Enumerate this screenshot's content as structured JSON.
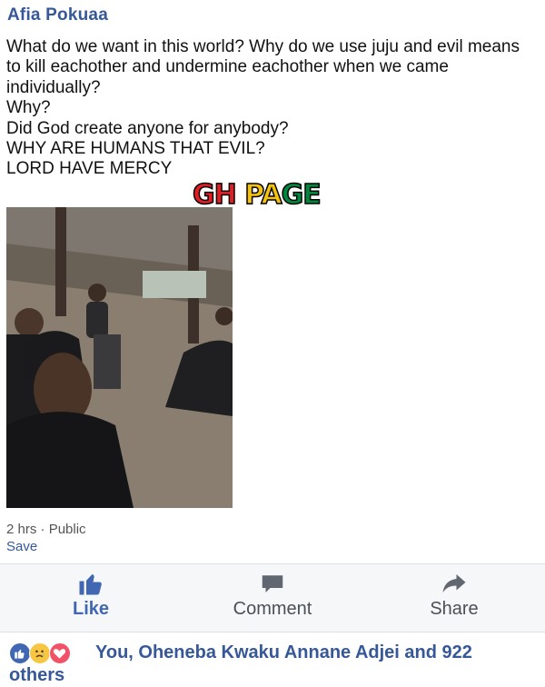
{
  "post": {
    "author": "Afia Pokuaa",
    "lines": [
      "What do we want in this world? Why do we use juju and evil means to kill eachother and undermine eachother when we came individually?",
      "Why?",
      "Did God create anyone for anybody?",
      "WHY ARE HUMANS THAT EVIL?",
      "LORD HAVE MERCY"
    ],
    "watermark": {
      "gh": "GH",
      "page_p": "PA",
      "page_ge": "GE"
    },
    "time": "2 hrs",
    "separator": "·",
    "privacy": "Public",
    "save_label": "Save"
  },
  "actions": {
    "like_label": "Like",
    "comment_label": "Comment",
    "share_label": "Share"
  },
  "reactions": {
    "icons": [
      "like-icon",
      "sad-icon",
      "love-icon"
    ],
    "summary": "You, Oheneba Kwaku Annane Adjei and 922 others"
  },
  "colors": {
    "link_blue": "#365899",
    "like_blue": "#4267b2",
    "action_bar_bg": "#f6f7f9"
  }
}
